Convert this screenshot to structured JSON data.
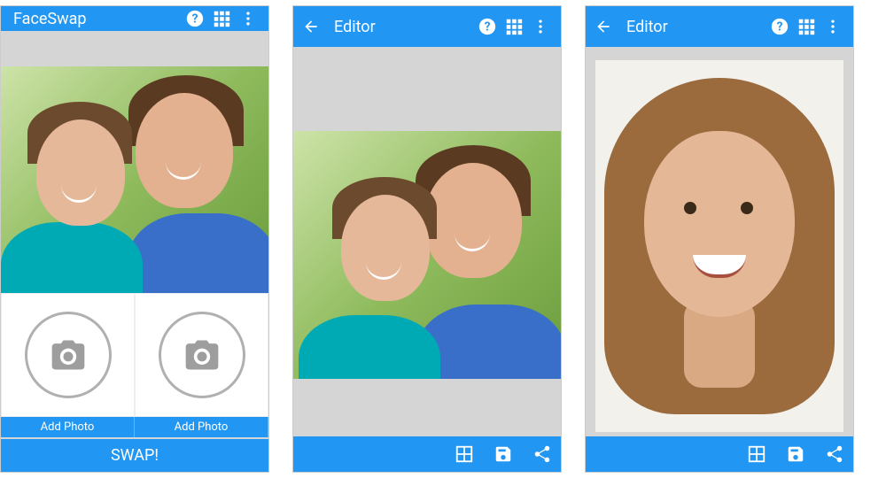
{
  "screens": [
    {
      "appbar": {
        "title": "FaceSwap",
        "hasBack": false
      },
      "addPhoto1": "Add Photo",
      "addPhoto2": "Add Photo",
      "swap": "SWAP!"
    },
    {
      "appbar": {
        "title": "Editor",
        "hasBack": true
      }
    },
    {
      "appbar": {
        "title": "Editor",
        "hasBack": true
      }
    }
  ],
  "icons": {
    "help": "help-icon",
    "grid": "grid-icon",
    "overflow": "overflow-icon",
    "back": "back-icon",
    "layout": "layout-icon",
    "save": "save-icon",
    "share": "share-icon",
    "camera": "camera-icon"
  },
  "colors": {
    "primary": "#2196f3"
  }
}
